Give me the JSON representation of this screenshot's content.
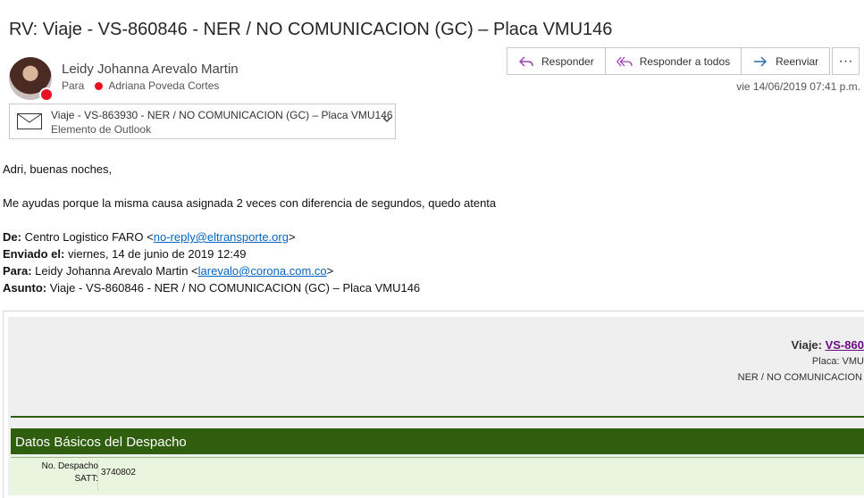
{
  "subject": "RV: Viaje - VS-860846 - NER / NO COMUNICACION (GC) – Placa VMU146",
  "header": {
    "sender_name": "Leidy Johanna Arevalo Martin",
    "to_label": "Para",
    "recipient": "Adriana Poveda Cortes",
    "date": "vie 14/06/2019 07:41 p.m."
  },
  "toolbar": {
    "reply_label": "Responder",
    "reply_all_label": "Responder a todos",
    "forward_label": "Reenviar",
    "more_label": "···"
  },
  "attachment": {
    "name": "Viaje - VS-863930 - NER / NO COMUNICACION (GC) – Placa VMU146",
    "type": "Elemento de Outlook"
  },
  "body": {
    "greeting": "Adri, buenas noches,",
    "message": "Me ayudas porque la misma causa asignada 2 veces con diferencia de segundos, quedo atenta",
    "from_label": "De:",
    "from_name": "Centro Logistico FARO <",
    "from_email": "no-reply@eltransporte.org",
    "from_close": ">",
    "sent_label": "Enviado el:",
    "sent_value": "viernes, 14 de junio de 2019 12:49",
    "to_label": "Para:",
    "to_name": "Leidy Johanna Arevalo Martin <",
    "to_email": "larevalo@corona.com.co",
    "to_close": ">",
    "subject_label": "Asunto:",
    "subject_value": "Viaje - VS-860846 - NER / NO COMUNICACION (GC) – Placa VMU146"
  },
  "embedded": {
    "trip_label": "Viaje:",
    "trip_link": "VS-860",
    "plate_line": "Placa: VMU",
    "status_line": "NER / NO COMUNICACION",
    "section_title": "Datos Básicos del Despacho",
    "dispatch_label": "No. Despacho SATT:",
    "dispatch_value": "3740802"
  },
  "colors": {
    "section_green": "#2f5f0e",
    "link_blue": "#0563c1",
    "link_purple": "#6a0d83",
    "presence_red": "#e81123"
  }
}
